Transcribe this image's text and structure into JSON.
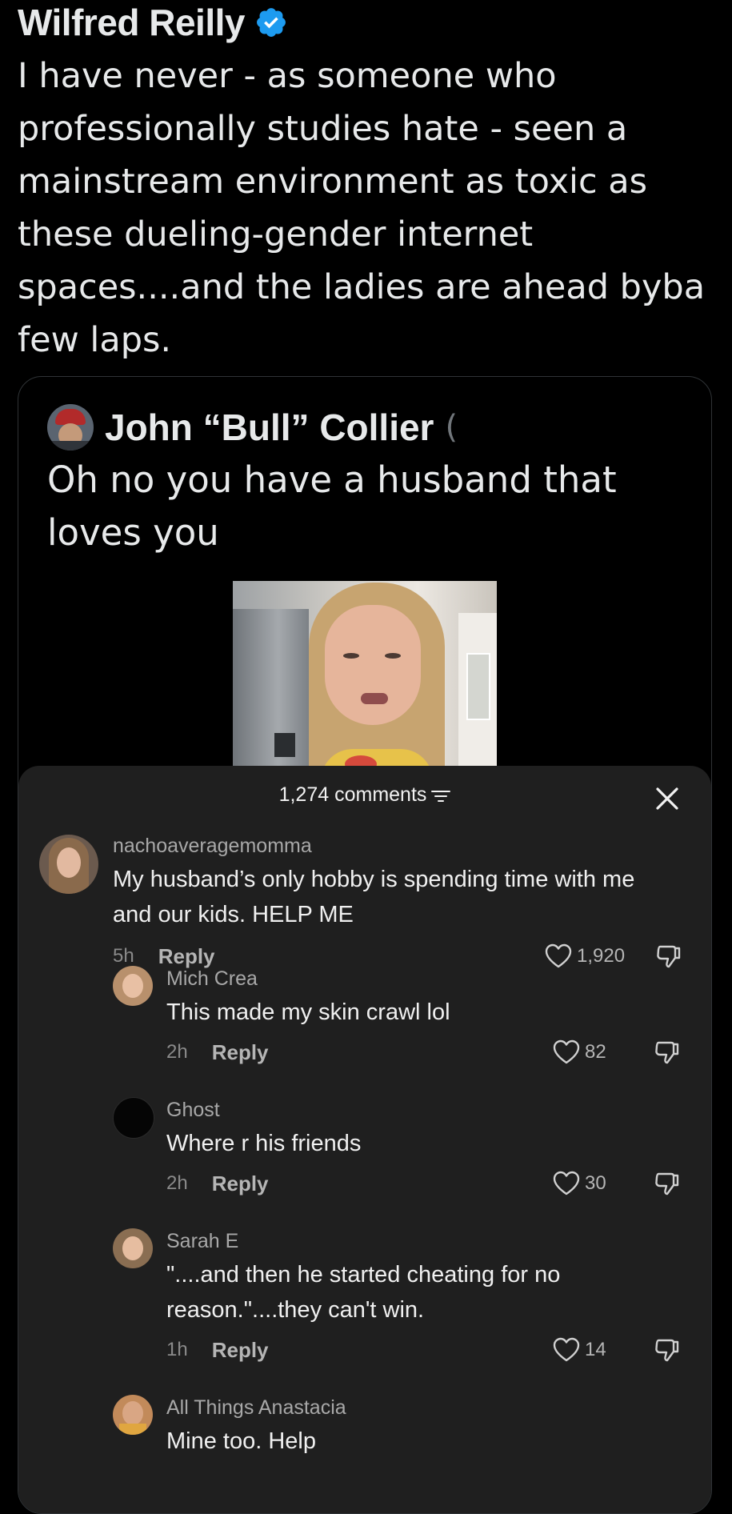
{
  "tweet": {
    "author": "Wilfred Reilly",
    "text": "I have never - as someone who professionally studies hate - seen a mainstream environment as toxic as these dueling-gender internet spaces....and the ladies are ahead byba few laps."
  },
  "quote": {
    "author": "John “Bull” Collier",
    "author_cut": "(",
    "text": "Oh no you have a husband that loves you"
  },
  "comments_panel": {
    "count_label": "1,274 comments",
    "comments": [
      {
        "user": "nachoaveragemomma",
        "text": "My husband’s only hobby is spending time with me and our kids. HELP ME",
        "time": "5h",
        "reply": "Reply",
        "likes": "1,920"
      },
      {
        "user": "Mich Crea",
        "text": "This made my skin crawl lol",
        "time": "2h",
        "reply": "Reply",
        "likes": "82"
      },
      {
        "user": "Ghost",
        "text": "Where r his friends",
        "time": "2h",
        "reply": "Reply",
        "likes": "30"
      },
      {
        "user": "Sarah E",
        "text": "\"....and then he started cheating for no reason.\"....they can't win.",
        "time": "1h",
        "reply": "Reply",
        "likes": "14"
      },
      {
        "user": "All Things Anastacia",
        "text": "Mine too. Help"
      }
    ]
  },
  "colors": {
    "verified": "#1d9bf0",
    "background": "#000000",
    "panel": "#1f1f1f"
  },
  "icons": [
    "verified-badge-icon",
    "filter-icon",
    "close-icon",
    "heart-icon",
    "dislike-icon"
  ]
}
